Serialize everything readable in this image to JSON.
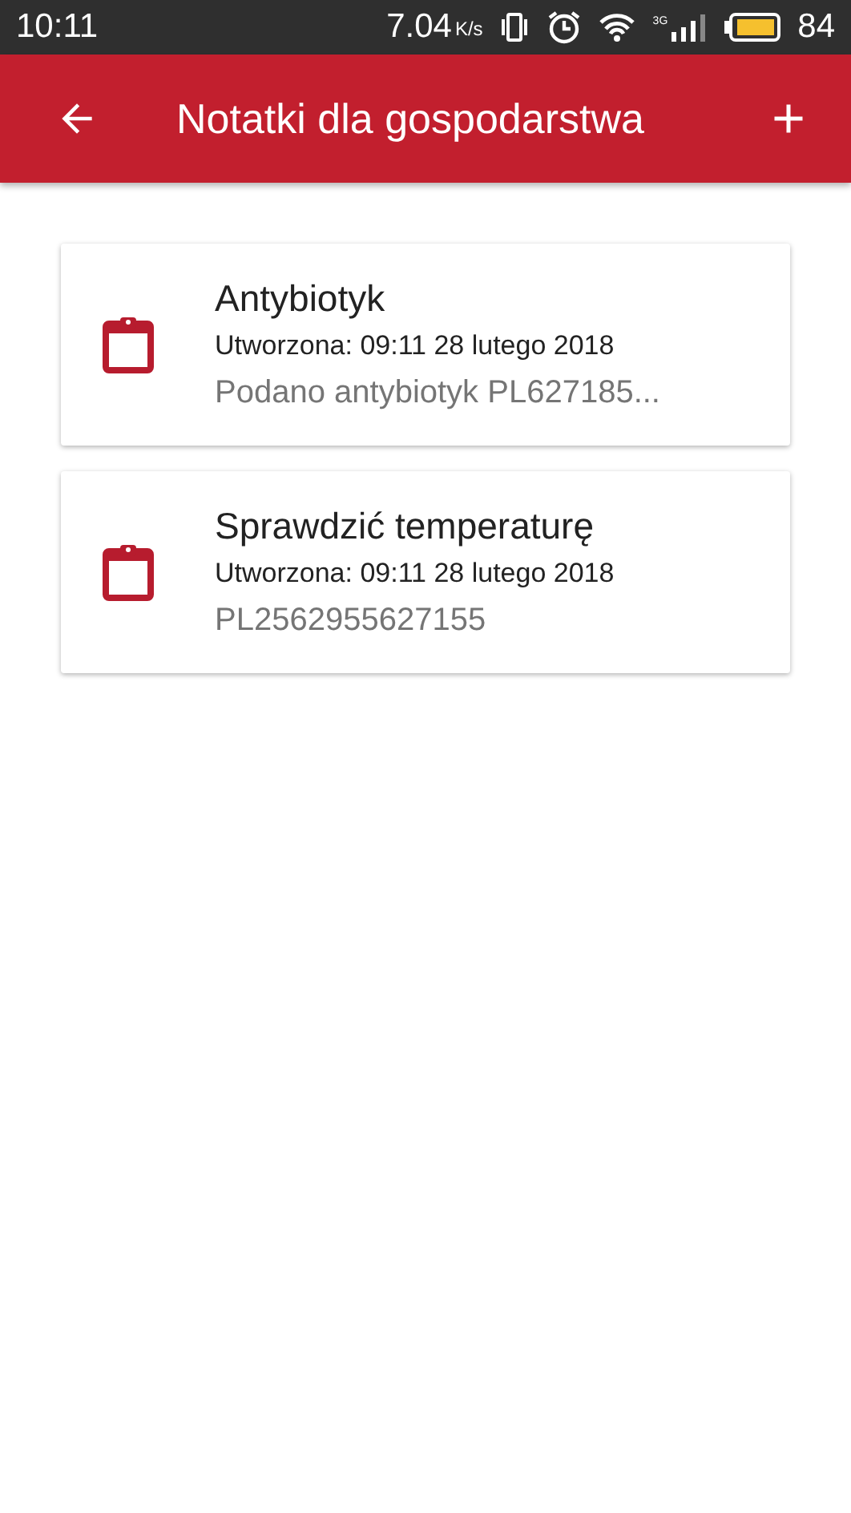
{
  "status_bar": {
    "time": "10:11",
    "speed": "7.04",
    "speed_unit": "K/s",
    "network": "3G",
    "battery": "84"
  },
  "app_bar": {
    "title": "Notatki dla gospodarstwa"
  },
  "notes": [
    {
      "title": "Antybiotyk",
      "created": "Utworzona: 09:11 28 lutego 2018",
      "preview": "Podano antybiotyk PL627185..."
    },
    {
      "title": "Sprawdzić temperaturę",
      "created": "Utworzona: 09:11 28 lutego 2018",
      "preview": "PL2562955627155"
    }
  ]
}
